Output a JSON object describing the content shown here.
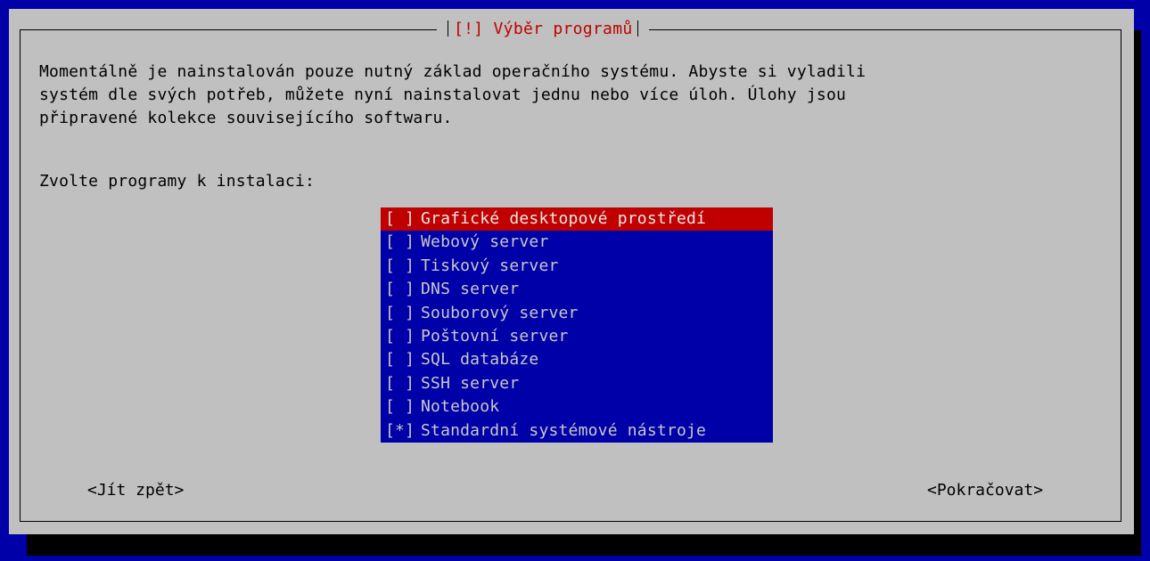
{
  "dialog": {
    "title": "[!] Výběr programů",
    "description_lines": [
      "Momentálně je nainstalován pouze nutný základ operačního systému. Abyste si vyladili",
      "systém dle svých potřeb, můžete nyní nainstalovat jednu nebo více úloh. Úlohy jsou",
      "připravené kolekce souvisejícího softwaru."
    ],
    "prompt": "Zvolte programy k instalaci:"
  },
  "tasks": [
    {
      "check": "[ ]",
      "label": "Grafické desktopové prostředí",
      "selected": true
    },
    {
      "check": "[ ]",
      "label": "Webový server",
      "selected": false
    },
    {
      "check": "[ ]",
      "label": "Tiskový server",
      "selected": false
    },
    {
      "check": "[ ]",
      "label": "DNS server",
      "selected": false
    },
    {
      "check": "[ ]",
      "label": "Souborový server",
      "selected": false
    },
    {
      "check": "[ ]",
      "label": "Poštovní server",
      "selected": false
    },
    {
      "check": "[ ]",
      "label": "SQL databáze",
      "selected": false
    },
    {
      "check": "[ ]",
      "label": "SSH server",
      "selected": false
    },
    {
      "check": "[ ]",
      "label": "Notebook",
      "selected": false
    },
    {
      "check": "[*]",
      "label": "Standardní systémové nástroje",
      "selected": false
    }
  ],
  "buttons": {
    "back": "<Jít zpět>",
    "continue": "<Pokračovat>"
  },
  "colors": {
    "background": "#0000a8",
    "dialog": "#c0c0c0",
    "accent": "#c00000",
    "list_text": "#c8c8c8"
  }
}
